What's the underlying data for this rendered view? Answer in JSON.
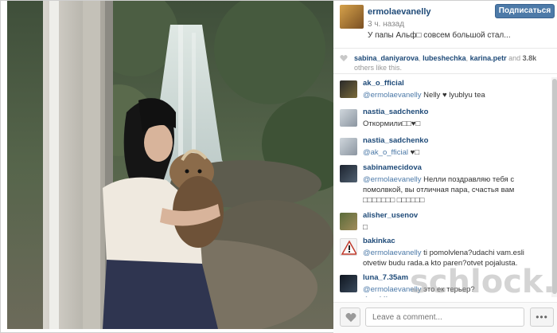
{
  "post": {
    "owner_username": "ermolaevanelly",
    "time_ago": "3 ч. назад",
    "caption": "У папы Альф□ совсем большой стал...",
    "subscribe_label": "Подписаться"
  },
  "likes": {
    "users": [
      "sabina_daniyarova",
      "lubeshechka",
      "karina.petr"
    ],
    "sep1": ", ",
    "sep2": ", ",
    "and": " and ",
    "count": "3.8k",
    "suffix": "others like this."
  },
  "comments": [
    {
      "user": "ak_o_fficial",
      "mention": "@ermolaevanelly",
      "text": " Nelly ♥ lyublyu tea"
    },
    {
      "user": "nastia_sadchenko",
      "mention": "",
      "text": "Откормили□□♥□"
    },
    {
      "user": "nastia_sadchenko",
      "mention": "@ak_o_fficial",
      "text": " ♥□"
    },
    {
      "user": "sabinamecidova",
      "mention": "@ermolaevanelly",
      "text": " Нелли поздравляю тебя с помолвкой, вы отличная пара, счастья вам □□□□□□□ □□□□□□"
    },
    {
      "user": "alisher_usenov",
      "mention": "",
      "text": "□"
    },
    {
      "user": "bakinkac",
      "mention": "@ermolaevanelly",
      "text": " ti pomolvlena?udachi vam.esli otvetiw budu rada.a kto paren?otvet pojalusta."
    },
    {
      "user": "luna_7.35am",
      "mention": "@ermolaevanelly",
      "text": " это ек терьер?"
    },
    {
      "user": "dorakliman",
      "mention": "",
      "text": ""
    }
  ],
  "composer": {
    "placeholder": "Leave a comment...",
    "more_label": "•••"
  },
  "watermark": "schlock.ru",
  "icons": {
    "like": "heart-icon",
    "more": "ellipsis-icon"
  },
  "colors": {
    "username": "#1e4a78",
    "accent_button": "#4d7aa8",
    "mention": "#4d7aa8"
  }
}
